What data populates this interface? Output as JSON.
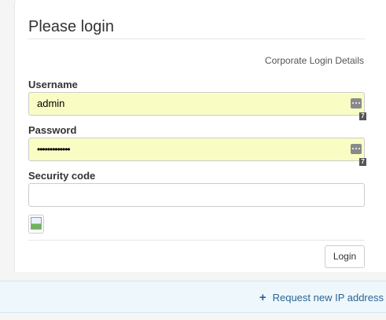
{
  "form": {
    "title": "Please login",
    "corporate_link": "Corporate Login Details",
    "username": {
      "label": "Username",
      "value": "admin",
      "manager_badge": "7"
    },
    "password": {
      "label": "Password",
      "value_masked": "•••••••••••••",
      "manager_badge": "7"
    },
    "security_code": {
      "label": "Security code",
      "value": ""
    },
    "login_button": "Login"
  },
  "footer": {
    "request_ip_label": "Request new IP address"
  },
  "colors": {
    "autofill_bg": "#fafdc3",
    "link": "#2a6496",
    "footer_bg": "#eef7fb"
  }
}
